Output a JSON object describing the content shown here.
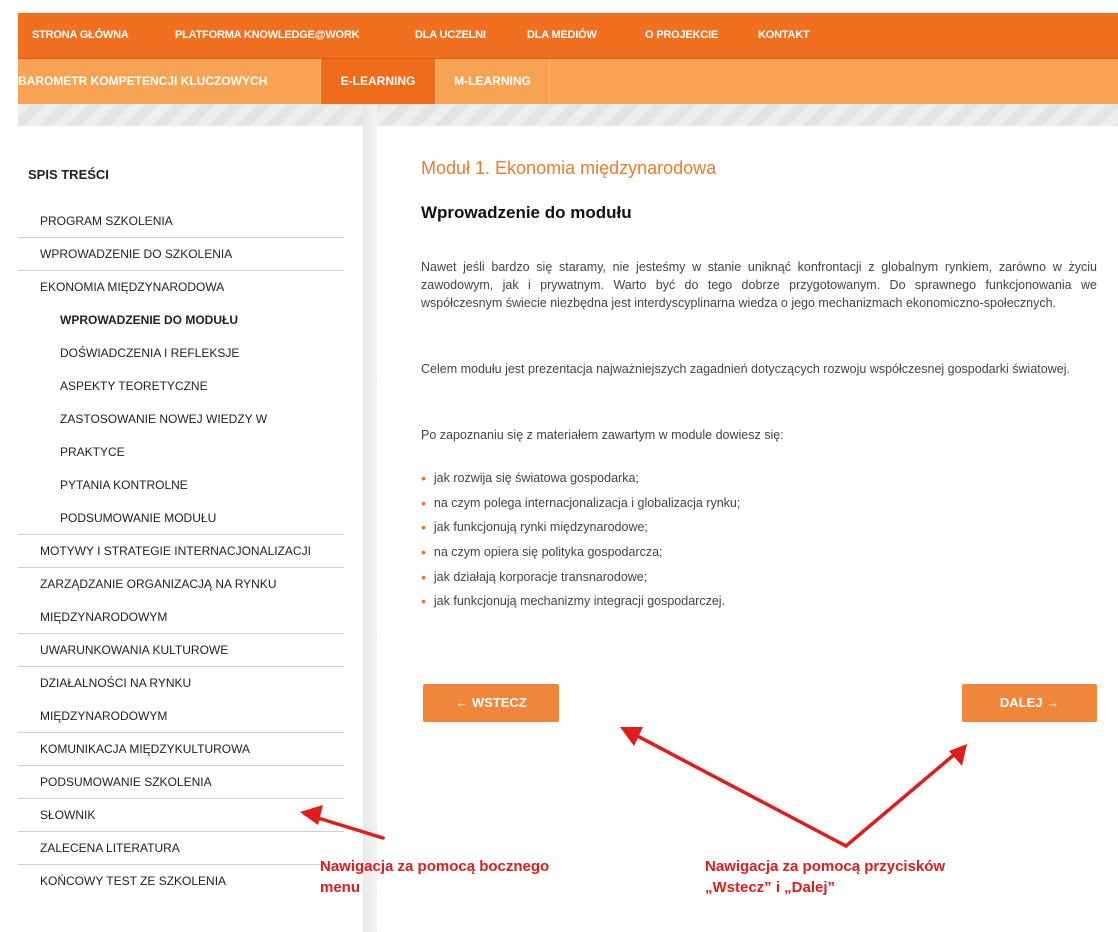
{
  "top_nav": {
    "items": [
      "STRONA GŁÓWNA",
      "PLATFORMA KNOWLEDGE@WORK",
      "DLA UCZELNI",
      "DLA MEDIÓW",
      "O PROJEKCIE",
      "KONTAKT"
    ]
  },
  "sub_nav": {
    "items": [
      "BAROMETR KOMPETENCJI KLUCZOWYCH",
      "E-LEARNING",
      "M-LEARNING"
    ],
    "active": "E-LEARNING"
  },
  "sidebar": {
    "title": "SPIS TREŚCI",
    "items": [
      "PROGRAM SZKOLENIA",
      "WPROWADZENIE DO SZKOLENIA",
      "EKONOMIA MIĘDZYNARODOWA",
      "WPROWADZENIE DO MODUŁU",
      "DOŚWIADCZENIA I REFLEKSJE",
      "ASPEKTY TEORETYCZNE",
      "ZASTOSOWANIE NOWEJ WIEDZY W",
      "PRAKTYCE",
      "PYTANIA KONTROLNE",
      "PODSUMOWANIE MODUŁU",
      "MOTYWY I STRATEGIE INTERNACJONALIZACJI",
      "ZARZĄDZANIE ORGANIZACJĄ NA RYNKU",
      "MIĘDZYNARODOWYM",
      "UWARUNKOWANIA KULTUROWE",
      "DZIAŁALNOŚCI NA RYNKU",
      "MIĘDZYNARODOWYM",
      "KOMUNIKACJA MIĘDZYKULTUROWA",
      "PODSUMOWANIE SZKOLENIA",
      "SŁOWNIK",
      "ZALECENA LITERATURA",
      "KOŃCOWY TEST ZE SZKOLENIA"
    ]
  },
  "main": {
    "module_title": "Moduł 1. Ekonomia międzynarodowa",
    "section_title": "Wprowadzenie do modułu",
    "paragraphs": [
      "Nawet jeśli bardzo się staramy, nie jesteśmy w stanie uniknąć konfrontacji z globalnym rynkiem, zarówno w życiu zawodowym, jak i prywatnym. Warto być do tego dobrze przygotowanym. Do sprawnego funkcjonowania we współczesnym świecie niezbędna jest interdyscyplinarna wiedza o jego mechanizmach ekonomiczno-społecznych.",
      "Celem modułu jest prezentacja najważniejszych zagadnień dotyczących rozwoju współczesnej gospodarki światowej.",
      "Po zapoznaniu się z materiałem zawartym w module dowiesz się:"
    ],
    "bullets": [
      "jak rozwija się światowa gospodarka;",
      "na czym polega internacjonalizacja i globalizacja rynku;",
      "jak funkcjonują rynki międzynarodowe;",
      "na czym opiera się polityka gospodarcza;",
      "jak działają korporacje transnarodowe;",
      "jak funkcjonują mechanizmy integracji gospodarczej."
    ],
    "back_button": "← WSTECZ",
    "next_button": "DALEJ →"
  },
  "annotations": {
    "sidebar_label_line1": "Nawigacja za pomocą bocznego",
    "sidebar_label_line2": "menu",
    "buttons_label_line1": "Nawigacja za pomocą przycisków",
    "buttons_label_line2": "„Wstecz” i „Dalej”",
    "color": "#e31b1b"
  },
  "colors": {
    "accent": "#f07020",
    "subnav": "#f7a353",
    "button": "#f0863a"
  }
}
